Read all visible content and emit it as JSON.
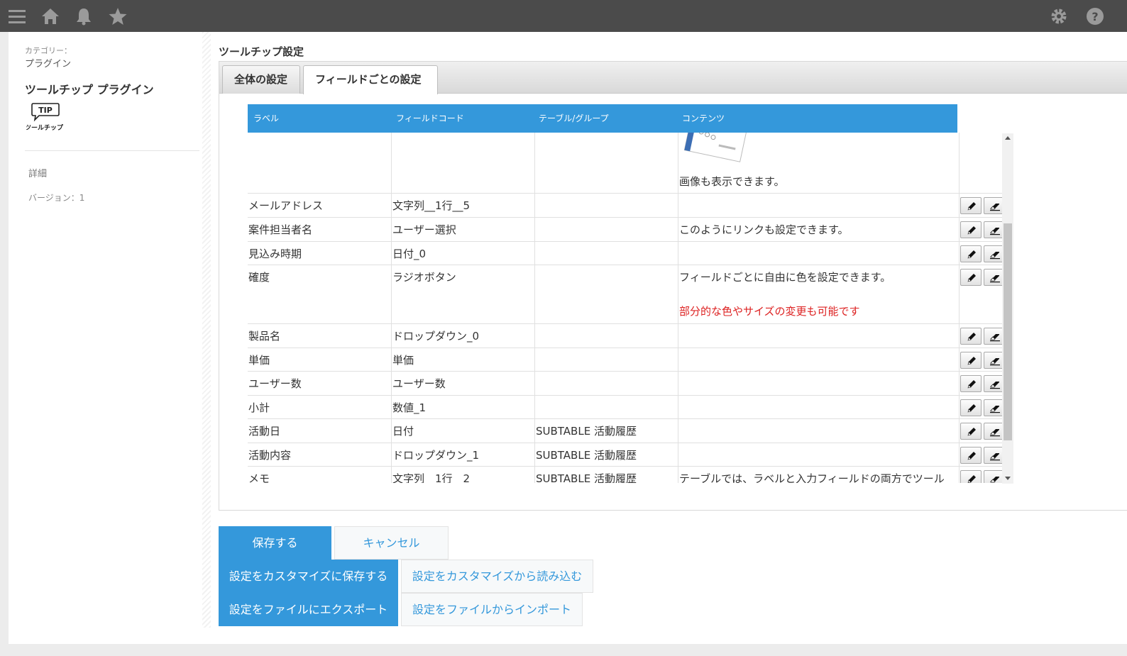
{
  "header": {
    "icons": [
      "menu-icon",
      "home-icon",
      "bell-icon",
      "star-icon",
      "gear-icon",
      "help-icon"
    ],
    "bg_color": "#4b4b4b"
  },
  "sidebar": {
    "category_caption": "カテゴリー：",
    "category_value": "プラグイン",
    "plugin_name": "ツールチップ プラグイン",
    "logo_tip": "TIP",
    "logo_text": "ツールチップ",
    "detail_link": "詳細",
    "version": "バージョン：1"
  },
  "main": {
    "section_title": "ツールチップ設定",
    "tabs": [
      {
        "label": "全体の設定",
        "active": false
      },
      {
        "label": "フィールドごとの設定",
        "active": true
      }
    ],
    "table": {
      "headers": [
        "ラベル",
        "フィールドコード",
        "テーブル/グループ",
        "コンテンツ"
      ],
      "image_caption": "画像も表示できます。",
      "rows": [
        {
          "label": "メールアドレス",
          "code": "文字列__1行__5",
          "group": "",
          "content": "",
          "content2": ""
        },
        {
          "label": "案件担当者名",
          "code": "ユーザー選択",
          "group": "",
          "content": "このようにリンクも設定できます。",
          "content2": ""
        },
        {
          "label": "見込み時期",
          "code": "日付_0",
          "group": "",
          "content": "",
          "content2": ""
        },
        {
          "label": "確度",
          "code": "ラジオボタン",
          "group": "",
          "content": "フィールドごとに自由に色を設定できます。",
          "content2": "部分的な色やサイズの変更も可能です"
        },
        {
          "label": "製品名",
          "code": "ドロップダウン_0",
          "group": "",
          "content": "",
          "content2": ""
        },
        {
          "label": "単価",
          "code": "単価",
          "group": "",
          "content": "",
          "content2": ""
        },
        {
          "label": "ユーザー数",
          "code": "ユーザー数",
          "group": "",
          "content": "",
          "content2": ""
        },
        {
          "label": "小計",
          "code": "数値_1",
          "group": "",
          "content": "",
          "content2": ""
        },
        {
          "label": "活動日",
          "code": "日付",
          "group": "SUBTABLE 活動履歴",
          "content": "",
          "content2": ""
        },
        {
          "label": "活動内容",
          "code": "ドロップダウン_1",
          "group": "SUBTABLE 活動履歴",
          "content": "",
          "content2": ""
        },
        {
          "label": "メモ",
          "code": "文字列__1行__2",
          "group": "SUBTABLE 活動履歴",
          "content": "テーブルでは、ラベルと入力フィールドの両方でツール",
          "content2": ""
        }
      ],
      "content_accent_color": "#dd2222"
    }
  },
  "actions": {
    "save": "保存する",
    "cancel": "キャンセル",
    "save_customize": "設定をカスタマイズに保存する",
    "load_customize": "設定をカスタマイズから読み込む",
    "export_file": "設定をファイルにエクスポート",
    "import_file": "設定をファイルからインポート",
    "primary_color": "#3498db"
  }
}
